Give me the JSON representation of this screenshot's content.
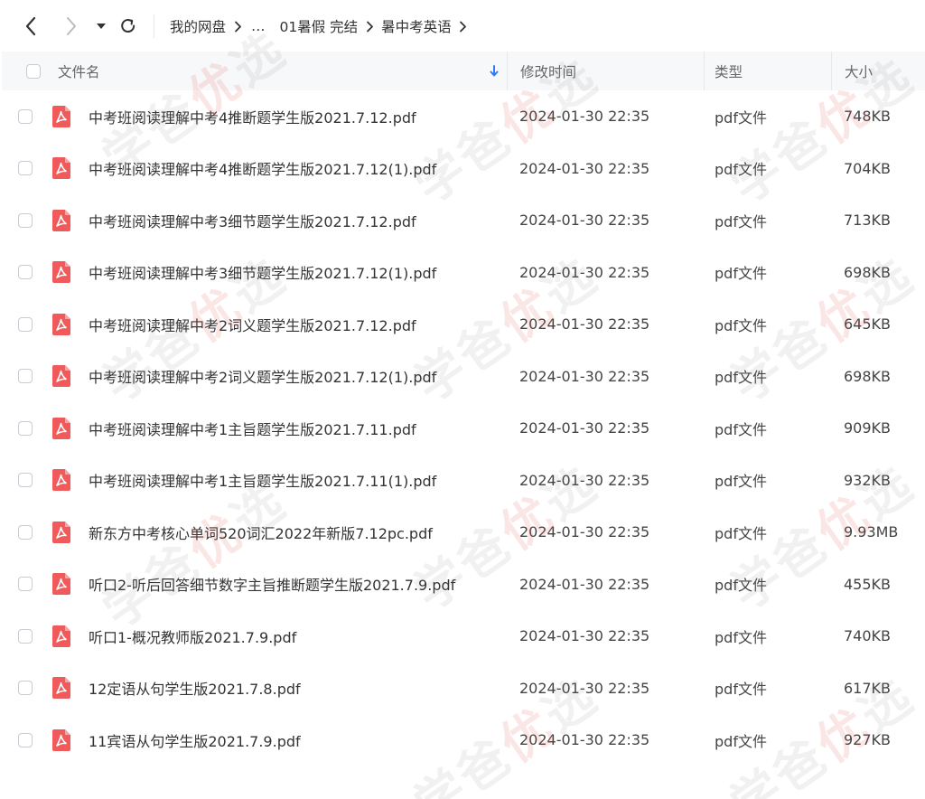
{
  "toolbar": {
    "back_icon": "chevron-left-icon",
    "forward_icon": "chevron-right-icon",
    "dropdown_icon": "caret-down-icon",
    "refresh_icon": "refresh-icon"
  },
  "breadcrumb": {
    "items": [
      "我的网盘",
      "…",
      "01暑假 完结",
      "暑中考英语"
    ]
  },
  "header": {
    "name_label": "文件名",
    "modified_label": "修改时间",
    "type_label": "类型",
    "size_label": "大小",
    "sort_icon": "sort-down-arrow-icon"
  },
  "files": [
    {
      "name": "中考班阅读理解中考4推断题学生版2021.7.12.pdf",
      "modified": "2024-01-30 22:35",
      "type": "pdf文件",
      "size": "748KB"
    },
    {
      "name": "中考班阅读理解中考4推断题学生版2021.7.12(1).pdf",
      "modified": "2024-01-30 22:35",
      "type": "pdf文件",
      "size": "704KB"
    },
    {
      "name": "中考班阅读理解中考3细节题学生版2021.7.12.pdf",
      "modified": "2024-01-30 22:35",
      "type": "pdf文件",
      "size": "713KB"
    },
    {
      "name": "中考班阅读理解中考3细节题学生版2021.7.12(1).pdf",
      "modified": "2024-01-30 22:35",
      "type": "pdf文件",
      "size": "698KB"
    },
    {
      "name": "中考班阅读理解中考2词义题学生版2021.7.12.pdf",
      "modified": "2024-01-30 22:35",
      "type": "pdf文件",
      "size": "645KB"
    },
    {
      "name": "中考班阅读理解中考2词义题学生版2021.7.12(1).pdf",
      "modified": "2024-01-30 22:35",
      "type": "pdf文件",
      "size": "698KB"
    },
    {
      "name": "中考班阅读理解中考1主旨题学生版2021.7.11.pdf",
      "modified": "2024-01-30 22:35",
      "type": "pdf文件",
      "size": "909KB"
    },
    {
      "name": "中考班阅读理解中考1主旨题学生版2021.7.11(1).pdf",
      "modified": "2024-01-30 22:35",
      "type": "pdf文件",
      "size": "932KB"
    },
    {
      "name": "新东方中考核心单词520词汇2022年新版7.12pc.pdf",
      "modified": "2024-01-30 22:35",
      "type": "pdf文件",
      "size": "9.93MB"
    },
    {
      "name": "听口2-听后回答细节数字主旨推断题学生版2021.7.9.pdf",
      "modified": "2024-01-30 22:35",
      "type": "pdf文件",
      "size": "455KB"
    },
    {
      "name": "听口1-概况教师版2021.7.9.pdf",
      "modified": "2024-01-30 22:35",
      "type": "pdf文件",
      "size": "740KB"
    },
    {
      "name": "12定语从句学生版2021.7.8.pdf",
      "modified": "2024-01-30 22:35",
      "type": "pdf文件",
      "size": "617KB"
    },
    {
      "name": "11宾语从句学生版2021.7.9.pdf",
      "modified": "2024-01-30 22:35",
      "type": "pdf文件",
      "size": "927KB"
    }
  ],
  "watermark": {
    "text_a": "学爸",
    "text_b": "优",
    "text_c": "选"
  },
  "colors": {
    "pdf_icon": "#f05a5a",
    "sort_arrow": "#2f7bf5",
    "header_bg": "#f7f8fa"
  }
}
